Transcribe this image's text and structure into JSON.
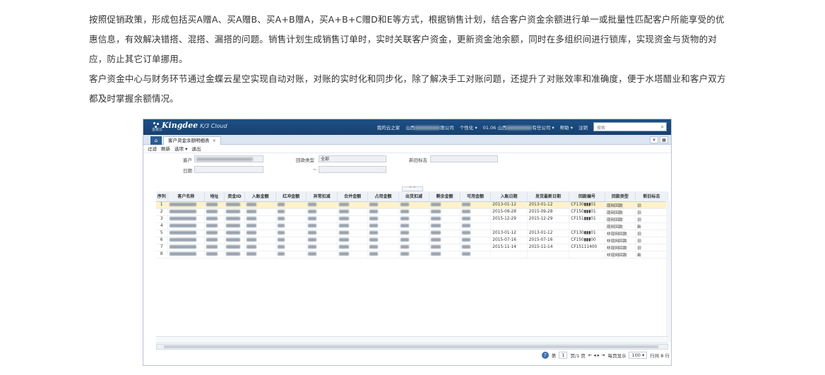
{
  "article": {
    "p1": "按照促销政策，形成包括买A赠A、买A赠B、买A+B赠A，买A+B+C赠D和E等方式，根据销售计划，结合客户资金余额进行单一或批量性匹配客户所能享受的优惠信息，有效解决错搭、混搭、漏搭的问题。销售计划生成销售订单时，实时关联客户资金，更新资金池余额，同时在多组织间进行锁库，实现资金与货物的对应，防止其它订单挪用。",
    "p2": "客户资金中心与财务环节通过金蝶云星空实现自动对账，对账的实时化和同步化，除了解决手工对账问题，还提升了对账效率和准确度，便于水塔醋业和客户双方都及时掌握余额情况。"
  },
  "app": {
    "brand": "Kingdee",
    "product": "K/3 Cloud",
    "brand_sub": "金蝶云",
    "nav": {
      "home": "我的云之家",
      "region": "山西",
      "company_suffix": "限公司",
      "personalize": "个性化 ▾",
      "period": "01.06 山西",
      "org_suffix": "有任公司 ▾",
      "help": "帮助 ▾",
      "logout": "注销"
    },
    "search_placeholder": "搜索",
    "home_tab_icon": "⌂",
    "current_tab": "客户资金余额明细表",
    "toolbar": [
      "过滤",
      "刷新",
      "选项 ▾",
      "退出"
    ]
  },
  "filter": {
    "customer_label": "客户",
    "payment_type_label": "回款类型",
    "payment_type_value": "全部",
    "newold_label": "新旧标志",
    "date_label": "日期",
    "date_sep": "~",
    "collapse": "^ ^"
  },
  "grid": {
    "columns": [
      "序列",
      "客户名称",
      "地址",
      "资金ID",
      "入账金额",
      "红冲金额",
      "异常扣减",
      "合并金额",
      "占用金额",
      "出货扣减",
      "剩余金额",
      "可用金额",
      "入账日期",
      "发货最新日期",
      "回款编号",
      "回款类型",
      "新旧标志"
    ],
    "rows": [
      {
        "idx": "1",
        "entry_date": "2013-01-12",
        "ship_date": "2013-01-12",
        "code": "CF130▮▮▮01",
        "type": "现网回款",
        "flag": "旧",
        "selected": true
      },
      {
        "idx": "2",
        "entry_date": "2015-09-28",
        "ship_date": "2015-09-28",
        "code": "CF150▮▮▮01",
        "type": "现网回款",
        "flag": "旧",
        "selected": false
      },
      {
        "idx": "3",
        "entry_date": "2015-12-29",
        "ship_date": "2015-12-29",
        "code": "CF151▮▮▮01",
        "type": "现网回款",
        "flag": "旧",
        "selected": false
      },
      {
        "idx": "4",
        "entry_date": "",
        "ship_date": "",
        "code": "",
        "type": "现网回款",
        "flag": "新",
        "selected": false
      },
      {
        "idx": "5",
        "entry_date": "2013-01-12",
        "ship_date": "2013-01-12",
        "code": "CF130▮▮▮01",
        "type": "非现网回款",
        "flag": "旧",
        "selected": false
      },
      {
        "idx": "6",
        "entry_date": "2015-07-16",
        "ship_date": "2015-07-16",
        "code": "CF150▮▮▮00",
        "type": "非现网回款",
        "flag": "旧",
        "selected": false
      },
      {
        "idx": "7",
        "entry_date": "2015-11-14",
        "ship_date": "2015-11-14",
        "code": "CF15111400",
        "type": "非现网回款",
        "flag": "旧",
        "selected": false
      },
      {
        "idx": "8",
        "entry_date": "",
        "ship_date": "",
        "code": "",
        "type": "非现网回款",
        "flag": "新",
        "selected": false
      }
    ]
  },
  "pager": {
    "help_icon": "?",
    "page_prefix": "第",
    "page_value": "1",
    "page_of": "页/1 页",
    "nav_glyphs": "⇤ ◂ ▸ ⇥",
    "per_page_label": "每页显示",
    "per_page_value": "100 ▾",
    "total": "行共 8 行"
  }
}
